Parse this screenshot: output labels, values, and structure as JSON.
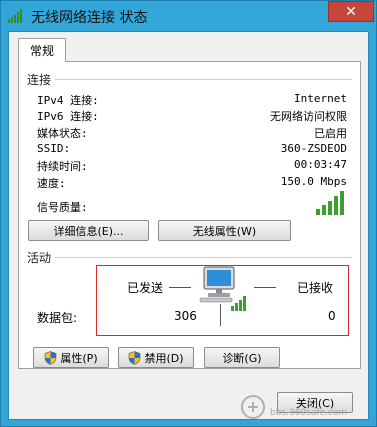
{
  "window": {
    "title": "无线网络连接 状态",
    "close_label": "✕"
  },
  "tabs": [
    {
      "label": "常规"
    }
  ],
  "connection": {
    "section_label": "连接",
    "rows": [
      {
        "label": "IPv4 连接:",
        "value": "Internet"
      },
      {
        "label": "IPv6 连接:",
        "value": "无网络访问权限"
      },
      {
        "label": "媒体状态:",
        "value": "已启用"
      },
      {
        "label": "SSID:",
        "value": "360-ZSDEOD"
      },
      {
        "label": "持续时间:",
        "value": "00:03:47"
      },
      {
        "label": "速度:",
        "value": "150.0 Mbps"
      }
    ],
    "signal_label": "信号质量:",
    "signal_bars": 5,
    "details_button": "详细信息(E)...",
    "wireless_props_button": "无线属性(W)"
  },
  "activity": {
    "section_label": "活动",
    "sent_label": "已发送",
    "received_label": "已接收",
    "packets_label": "数据包:",
    "sent_value": "306",
    "received_value": "0"
  },
  "actions": {
    "properties_button": "属性(P)",
    "disable_button": "禁用(D)",
    "diagnose_button": "诊断(G)",
    "close_button": "关闭(C)"
  },
  "watermark": {
    "text": "bbs.360safe.com"
  },
  "colors": {
    "titlebar": "#33a6d9",
    "close": "#c7463b",
    "signal_green": "#3aa12f",
    "highlight_red": "#d42a2a"
  }
}
